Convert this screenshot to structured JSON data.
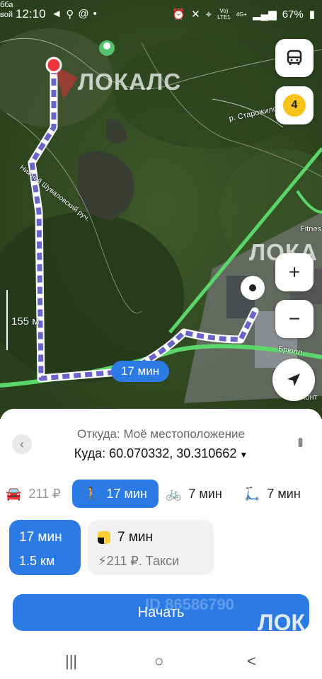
{
  "status_bar": {
    "left_text_line1": "бба",
    "left_text_line2": "вой",
    "time": "12:10",
    "left_icons": [
      "telegram-icon",
      "search-icon",
      "at-icon",
      "dot-icon"
    ],
    "signal_label_top": "Vo)",
    "signal_label_bottom": "LTE1",
    "network": "4G+",
    "battery": "67%"
  },
  "map": {
    "watermark_top": "ЛОКАЛС",
    "watermark_mid": "ЛОКА",
    "street_1": "р. Старожило",
    "street_2": "Нижний Шуваловский руч.",
    "street_3": "Брюлл",
    "street_4": "Конт",
    "poi_fitness": "Fitnes",
    "scale_label": "155 м",
    "route_time": "17 мин",
    "traffic_level": "4",
    "buttons": {
      "transit": "bus-icon",
      "zoom_in": "+",
      "zoom_out": "−",
      "locate": "navigation-arrow-icon"
    }
  },
  "route_sheet": {
    "from": "Откуда: Моё местоположение",
    "to": "Куда: 60.070332, 30.310662",
    "modes": [
      {
        "icon": "car-icon",
        "label": "211 ₽",
        "active": false
      },
      {
        "icon": "walk-icon",
        "label": "17 мин",
        "active": true
      },
      {
        "icon": "bike-icon",
        "label": "7 мин",
        "active": false
      },
      {
        "icon": "scooter-icon",
        "label": "7 мин",
        "active": false
      }
    ],
    "selected_option": {
      "time": "17 мин",
      "distance": "1.5 км"
    },
    "taxi_option": {
      "time": "7 мин",
      "price": "211 ₽. Такси"
    },
    "start_label": "Начать",
    "watermark": "ЛОК",
    "watermark_id": "ID 86586790"
  },
  "nav_bar": {
    "recents": "|||",
    "home": "○",
    "back": "<"
  },
  "colors": {
    "accent": "#2c7be5",
    "route": "#6a63c9",
    "road": "#5bd66a",
    "start_pin": "#f0343c"
  }
}
